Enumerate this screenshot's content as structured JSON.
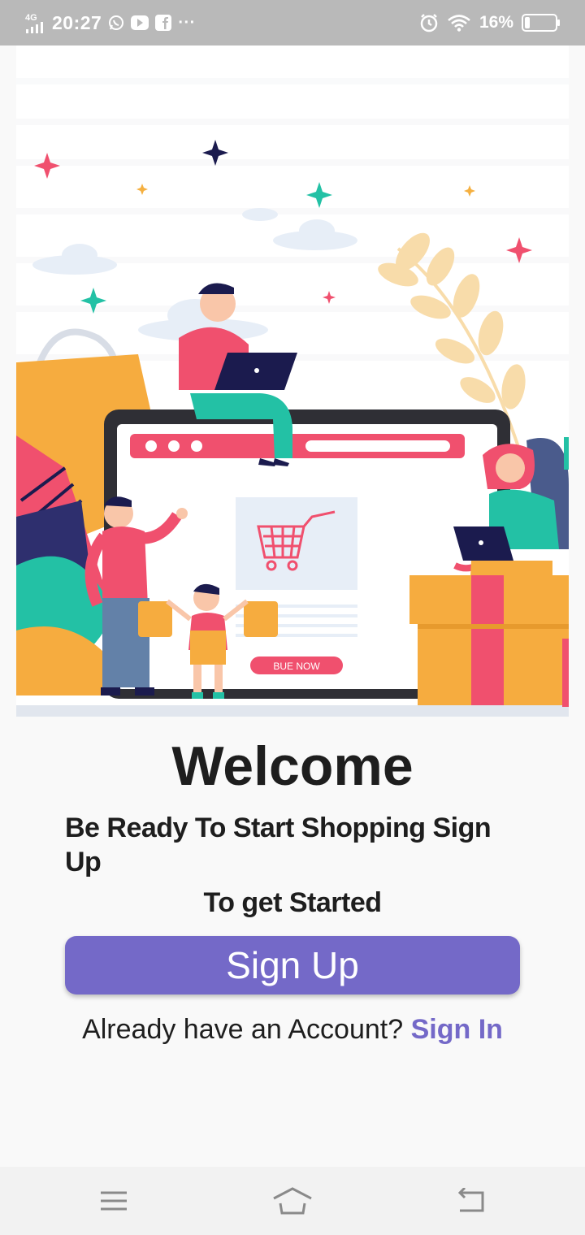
{
  "status_bar": {
    "network": "4G",
    "time": "20:27",
    "more": "···",
    "battery_percent": "16%",
    "battery_level": 0.16
  },
  "hero": {
    "buy_label": "BUE NOW"
  },
  "welcome": {
    "title": "Welcome",
    "subtitle_line1": "Be Ready To Start Shopping Sign Up",
    "subtitle_line2": "To get Started"
  },
  "actions": {
    "signup_label": "Sign Up",
    "account_prompt": "Already have an Account?",
    "signin_label": "Sign In"
  },
  "colors": {
    "accent": "#7469c8",
    "status_bar": "#b9b9b9",
    "text": "#1e1e1e"
  },
  "nav_bar": {
    "icons": [
      "menu-icon",
      "home-icon",
      "back-icon"
    ]
  }
}
